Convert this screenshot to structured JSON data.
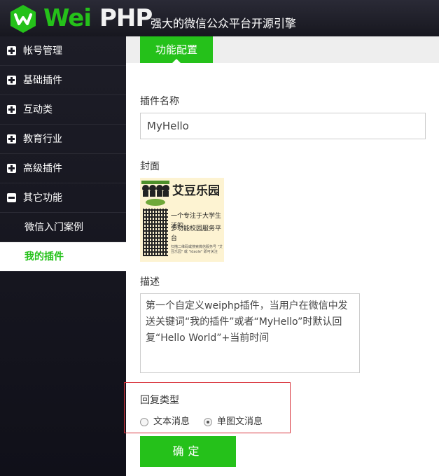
{
  "header": {
    "logo_wei": "Wei",
    "logo_php": "PHP",
    "slogan": "强大的微信公众平台开源引擎",
    "brand_color": "#25c11a"
  },
  "sidebar": {
    "groups": [
      {
        "label": "帐号管理",
        "icon": "plus-square-icon"
      },
      {
        "label": "基础插件",
        "icon": "plus-square-icon"
      },
      {
        "label": "互动类",
        "icon": "plus-square-icon"
      },
      {
        "label": "教育行业",
        "icon": "plus-square-icon"
      },
      {
        "label": "高级插件",
        "icon": "plus-square-icon"
      },
      {
        "label": "其它功能",
        "icon": "minus-square-icon"
      }
    ],
    "subitems": [
      {
        "label": "微信入门案例",
        "active": false
      },
      {
        "label": "我的插件",
        "active": true
      }
    ]
  },
  "main": {
    "tab_label": "功能配置",
    "name_label": "插件名称",
    "name_value": "MyHello",
    "cover_label": "封面",
    "cover_image": {
      "title": "艾豆乐园",
      "slogan_line1": "一个专注于大学生活的",
      "slogan_line2": "多功能校园服务平台",
      "fine_print": "扫描二维码或搜索微信服务号 \"艾豆乐园\" 或 \"idaole\" 即可关注"
    },
    "desc_label": "描述",
    "desc_value": "第一个自定义weiphp插件，当用户在微信中发送关键词“我的插件”或者“MyHello”时默认回复“Hello World”+当前时间",
    "reply_type_label": "回复类型",
    "reply_options": [
      {
        "label": "文本消息",
        "checked": false
      },
      {
        "label": "单图文消息",
        "checked": true
      }
    ],
    "submit_label": "确定"
  }
}
